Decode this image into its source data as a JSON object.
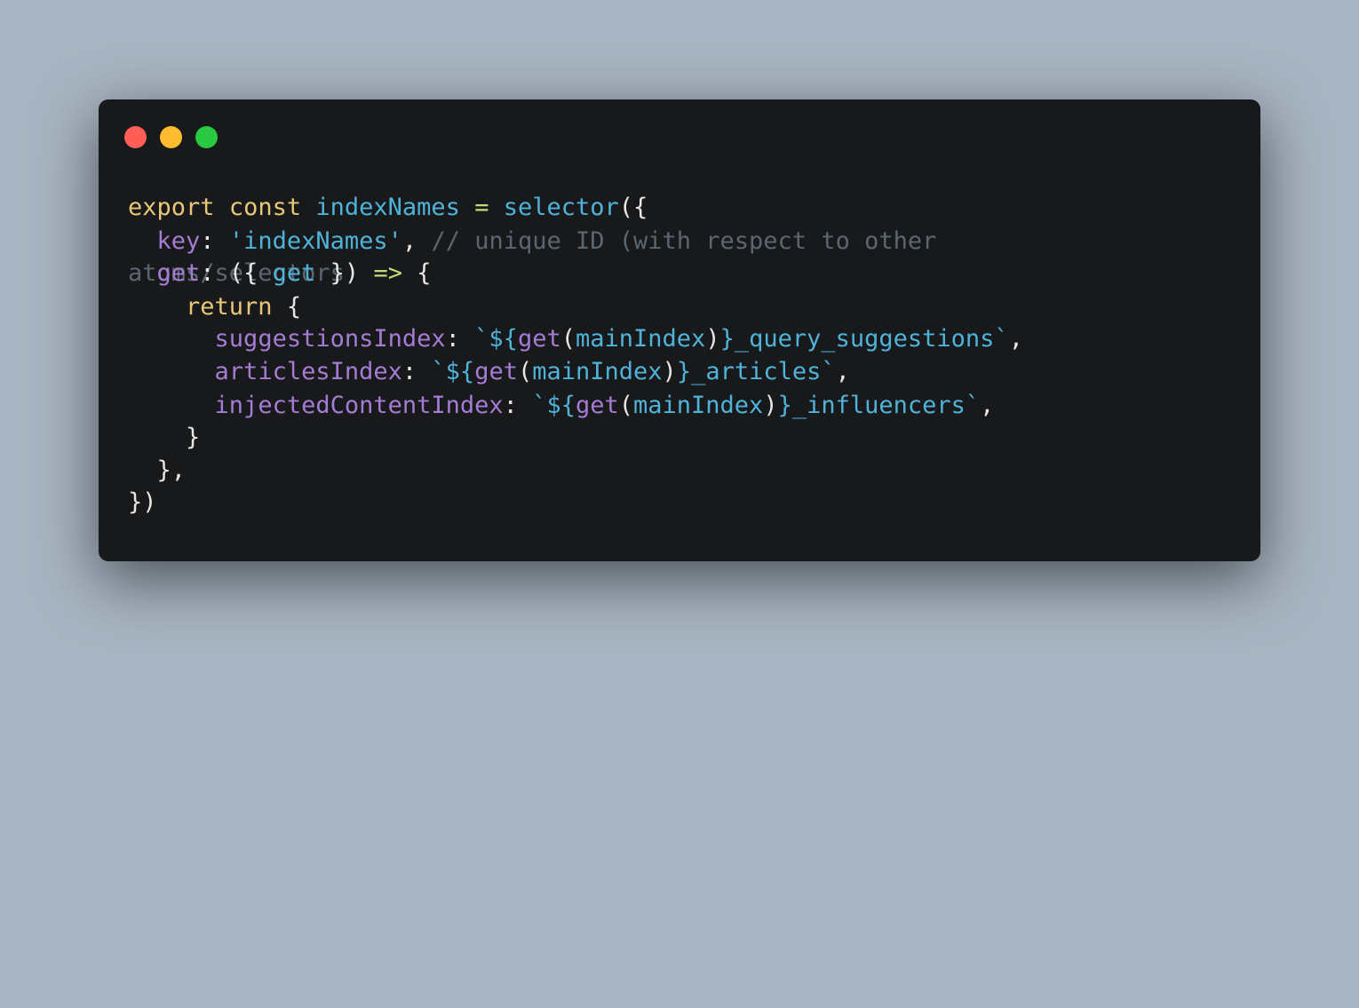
{
  "window": {
    "controls": [
      "close",
      "minimize",
      "maximize"
    ]
  },
  "code": {
    "l1": {
      "kw1": "export",
      "kw2": "const",
      "name": "indexNames",
      "eq": "=",
      "fn": "selector",
      "open": "({"
    },
    "l2": {
      "key": "key",
      "colon": ":",
      "value": "'indexNames'",
      "comma": ",",
      "comment": "// unique ID (with respect to other"
    },
    "l3": {
      "comment_wrap": "atoms/selectors)",
      "get": "get",
      "colon": ":",
      "open": "({",
      "arg": "get",
      "close": "})",
      "arrow": "=>",
      "brace": "{"
    },
    "l4": {
      "kw": "return",
      "brace": "{"
    },
    "l5": {
      "key": "suggestionsIndex",
      "colon": ":",
      "tick_open": "`${",
      "fn": "get",
      "paren_open": "(",
      "arg": "mainIndex",
      "paren_close": ")",
      "rest": "}_query_suggestions`",
      "comma": ","
    },
    "l6": {
      "key": "articlesIndex",
      "colon": ":",
      "tick_open": "`${",
      "fn": "get",
      "paren_open": "(",
      "arg": "mainIndex",
      "paren_close": ")",
      "rest": "}_articles`",
      "comma": ","
    },
    "l7": {
      "key": "injectedContentIndex",
      "colon": ":",
      "tick_open": "`${",
      "fn": "get",
      "paren_open": "(",
      "arg": "mainIndex",
      "paren_close": ")",
      "rest": "}_influencers`",
      "comma": ","
    },
    "l8": {
      "text": "}"
    },
    "l9": {
      "text": "},"
    },
    "l10": {
      "text": "})"
    }
  },
  "colors": {
    "background": "#a8b4c1",
    "window": "#18191b",
    "keyword": "#e8c779",
    "identifier": "#4fb3d9",
    "property": "#a57bd3",
    "operator": "#c6d97a",
    "comment": "#5c6670",
    "punctuation": "#e6e6e6"
  }
}
